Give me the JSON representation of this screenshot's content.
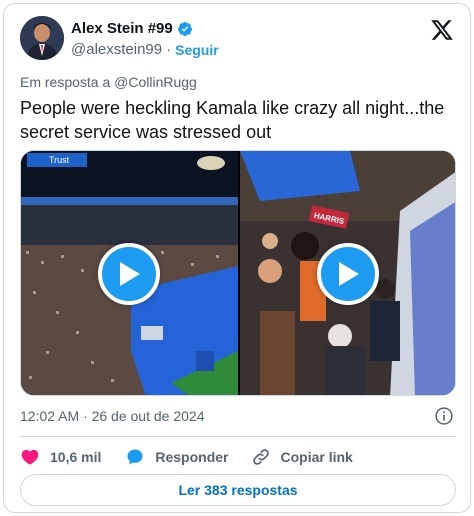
{
  "author": {
    "name": "Alex Stein #99",
    "handle": "@alexstein99",
    "separator": "·",
    "follow_label": "Seguir"
  },
  "tweet": {
    "reply_to": "Em resposta a @CollinRugg",
    "text": "People were heckling Kamala like crazy all night...the secret service was stressed out",
    "timestamp": "12:02 AM · 26 de out de 2024"
  },
  "media": {
    "videos": [
      {
        "name": "video-1",
        "overlay_text": "Trust"
      },
      {
        "name": "video-2",
        "overlay_text": "HARRIS"
      }
    ]
  },
  "actions": {
    "likes": "10,6 mil",
    "reply_label": "Responder",
    "copy_label": "Copiar link"
  },
  "replies_button": "Ler 383 respostas",
  "colors": {
    "accent": "#1d9bf0",
    "like_heart": "#f91880",
    "secondary_text": "#536471",
    "border": "#cfd9de"
  },
  "icons": [
    "verified-badge-icon",
    "x-logo-icon",
    "play-icon",
    "info-icon",
    "heart-icon",
    "reply-icon",
    "link-icon"
  ]
}
